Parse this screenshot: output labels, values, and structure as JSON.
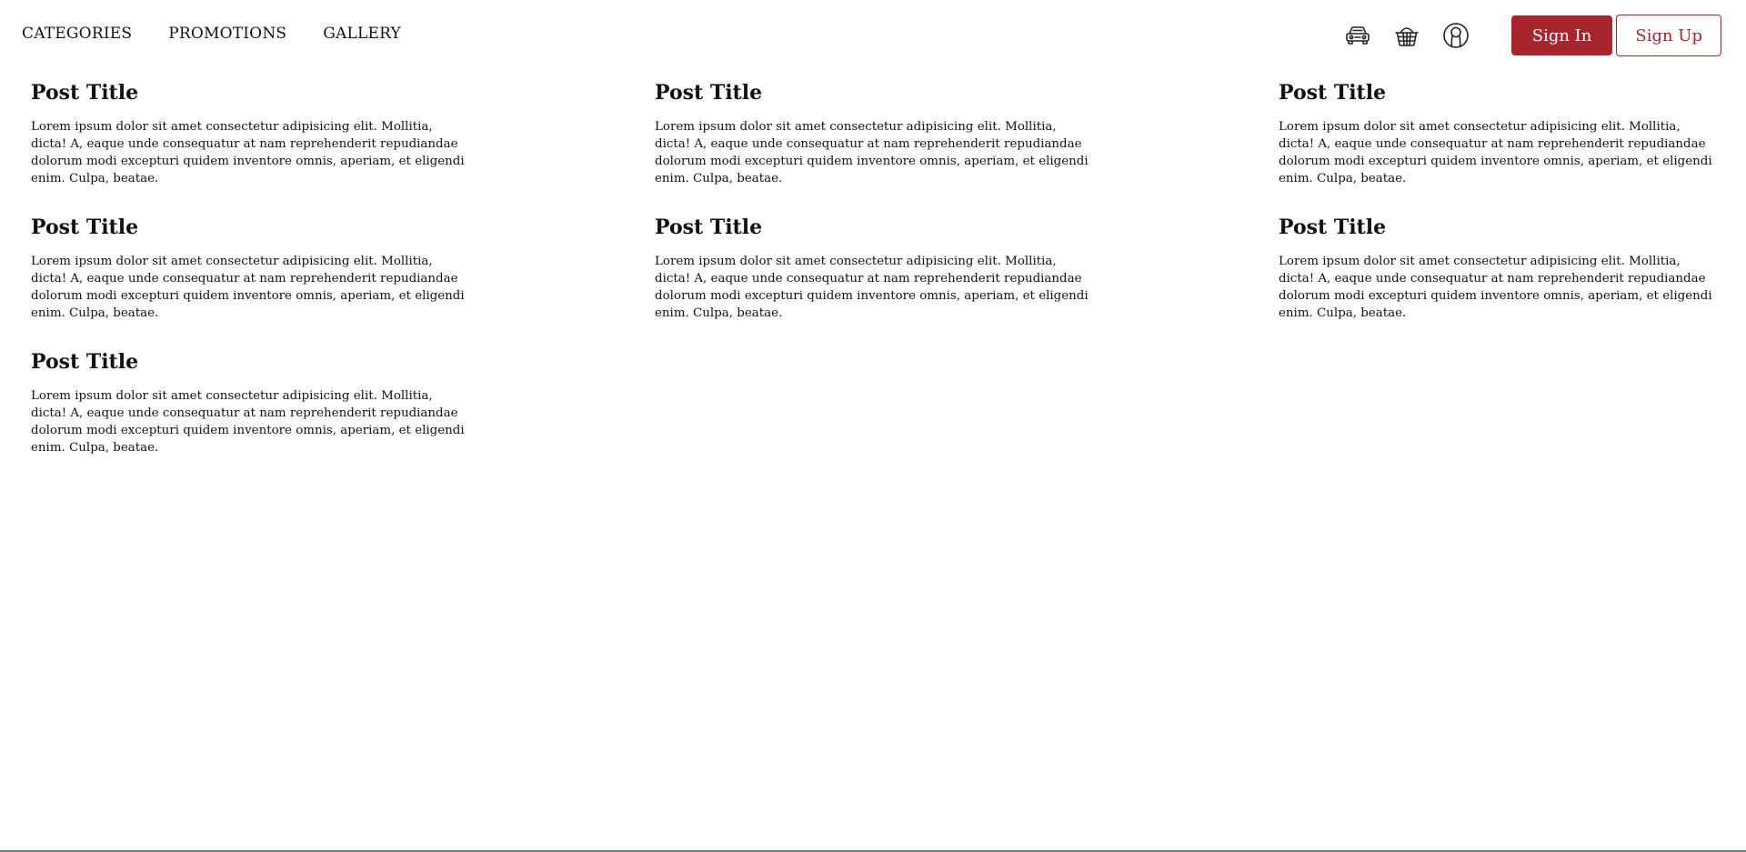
{
  "nav": {
    "items": [
      "CATEGORIES",
      "PROMOTIONS",
      "GALLERY"
    ]
  },
  "header": {
    "icons": [
      "car-icon",
      "basket-icon",
      "user-icon"
    ],
    "sign_in_label": "Sign In",
    "sign_up_label": "Sign Up"
  },
  "colors": {
    "accent": "#a8252e",
    "text": "#111111",
    "background": "#ffffff"
  },
  "posts": [
    {
      "title": "Post Title",
      "body": "Lorem ipsum dolor sit amet consectetur adipisicing elit. Mollitia, dicta! A, eaque unde consequatur at nam reprehenderit repudiandae dolorum modi excepturi quidem inventore omnis, aperiam, et eligendi enim. Culpa, beatae."
    },
    {
      "title": "Post Title",
      "body": "Lorem ipsum dolor sit amet consectetur adipisicing elit. Mollitia, dicta! A, eaque unde consequatur at nam reprehenderit repudiandae dolorum modi excepturi quidem inventore omnis, aperiam, et eligendi enim. Culpa, beatae."
    },
    {
      "title": "Post Title",
      "body": "Lorem ipsum dolor sit amet consectetur adipisicing elit. Mollitia, dicta! A, eaque unde consequatur at nam reprehenderit repudiandae dolorum modi excepturi quidem inventore omnis, aperiam, et eligendi enim. Culpa, beatae."
    },
    {
      "title": "Post Title",
      "body": "Lorem ipsum dolor sit amet consectetur adipisicing elit. Mollitia, dicta! A, eaque unde consequatur at nam reprehenderit repudiandae dolorum modi excepturi quidem inventore omnis, aperiam, et eligendi enim. Culpa, beatae."
    },
    {
      "title": "Post Title",
      "body": "Lorem ipsum dolor sit amet consectetur adipisicing elit. Mollitia, dicta! A, eaque unde consequatur at nam reprehenderit repudiandae dolorum modi excepturi quidem inventore omnis, aperiam, et eligendi enim. Culpa, beatae."
    },
    {
      "title": "Post Title",
      "body": "Lorem ipsum dolor sit amet consectetur adipisicing elit. Mollitia, dicta! A, eaque unde consequatur at nam reprehenderit repudiandae dolorum modi excepturi quidem inventore omnis, aperiam, et eligendi enim. Culpa, beatae."
    },
    {
      "title": "Post Title",
      "body": "Lorem ipsum dolor sit amet consectetur adipisicing elit. Mollitia, dicta! A, eaque unde consequatur at nam reprehenderit repudiandae dolorum modi excepturi quidem inventore omnis, aperiam, et eligendi enim. Culpa, beatae."
    }
  ]
}
